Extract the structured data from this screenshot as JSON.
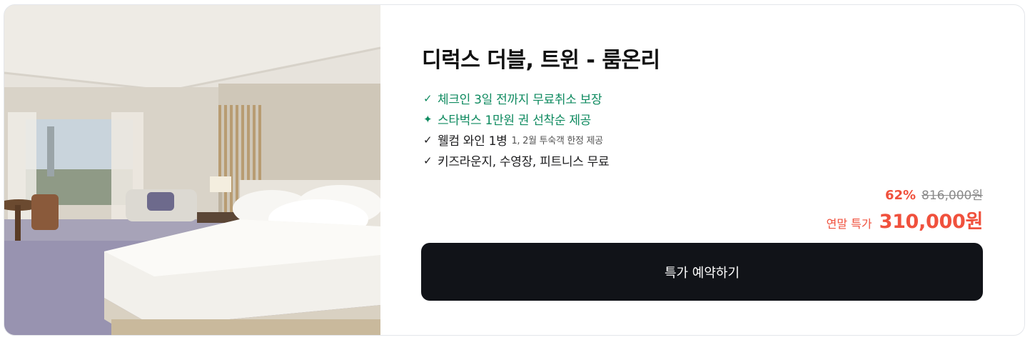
{
  "room": {
    "title": "디럭스 더블, 트윈 - 룸온리",
    "photo_alt": "room-photo"
  },
  "features": [
    {
      "icon": "check-icon",
      "glyph": "✓",
      "text": "체크인 3일 전까지 무료취소 보장",
      "note": "",
      "color": "#0e8a5f"
    },
    {
      "icon": "sparkle-icon",
      "glyph": "✦",
      "text": "스타벅스 1만원 권 선착순 제공",
      "note": "",
      "color": "#0e8a5f"
    },
    {
      "icon": "check-icon",
      "glyph": "✓",
      "text": "웰컴 와인 1병",
      "note": "1, 2월 투숙객 한정 제공",
      "color": "#1d1d1f"
    },
    {
      "icon": "check-icon",
      "glyph": "✓",
      "text": "키즈라운지, 수영장, 피트니스 무료",
      "note": "",
      "color": "#1d1d1f"
    }
  ],
  "price": {
    "discount": "62%",
    "original": "816,000원",
    "sale_label": "연말 특가",
    "sale_price": "310,000원",
    "accent_color": "#f0513d"
  },
  "cta": {
    "label": "특가 예약하기"
  }
}
